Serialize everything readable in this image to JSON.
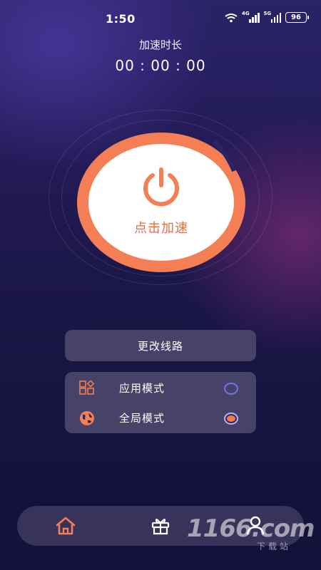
{
  "status_bar": {
    "time": "1:50",
    "network_1": "4G",
    "network_2": "5G",
    "battery": "96",
    "icons": [
      "wifi-icon",
      "signal-icon",
      "signal-icon",
      "battery-icon"
    ]
  },
  "duration": {
    "label": "加速时长",
    "value": "00 : 00 : 00"
  },
  "boost": {
    "label": "点击加速",
    "icon": "power-icon",
    "accent_color": "#f47f55"
  },
  "route_button": {
    "label": "更改线路"
  },
  "modes": [
    {
      "label": "应用模式",
      "icon": "app-grid-icon",
      "selected": false
    },
    {
      "label": "全局模式",
      "icon": "globe-icon",
      "selected": true
    }
  ],
  "tabbar": {
    "tabs": [
      {
        "name": "home",
        "icon": "home-icon",
        "active": true
      },
      {
        "name": "gift",
        "icon": "gift-icon",
        "active": false
      },
      {
        "name": "profile",
        "icon": "user-icon",
        "active": false
      }
    ]
  },
  "watermark": {
    "main": "1166.com",
    "sub": "下载站"
  }
}
